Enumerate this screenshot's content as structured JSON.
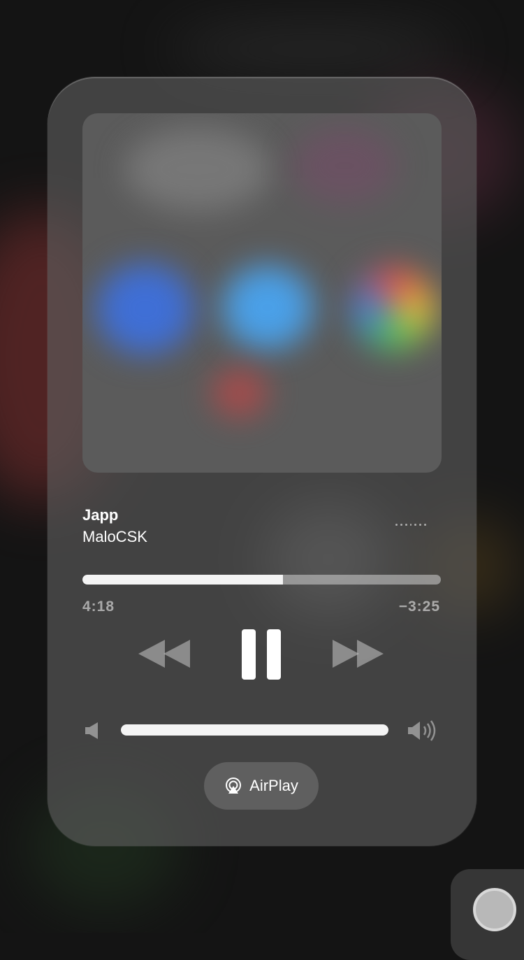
{
  "now_playing": {
    "title": "Japp",
    "artist": "MaloCSK",
    "progress_fraction": 0.56,
    "elapsed": "4:18",
    "remaining": "−3:25"
  },
  "controls": {
    "rewind_icon": "backward-icon",
    "pause_icon": "pause-icon",
    "forward_icon": "forward-icon"
  },
  "volume": {
    "level_fraction": 1.0,
    "low_icon": "speaker-low-icon",
    "high_icon": "speaker-high-icon"
  },
  "airplay": {
    "label": "AirPlay",
    "icon": "airplay-icon"
  },
  "colors": {
    "card": "#5f5f5f",
    "accent": "#ffffff",
    "muted_text": "#9a9a9a"
  }
}
